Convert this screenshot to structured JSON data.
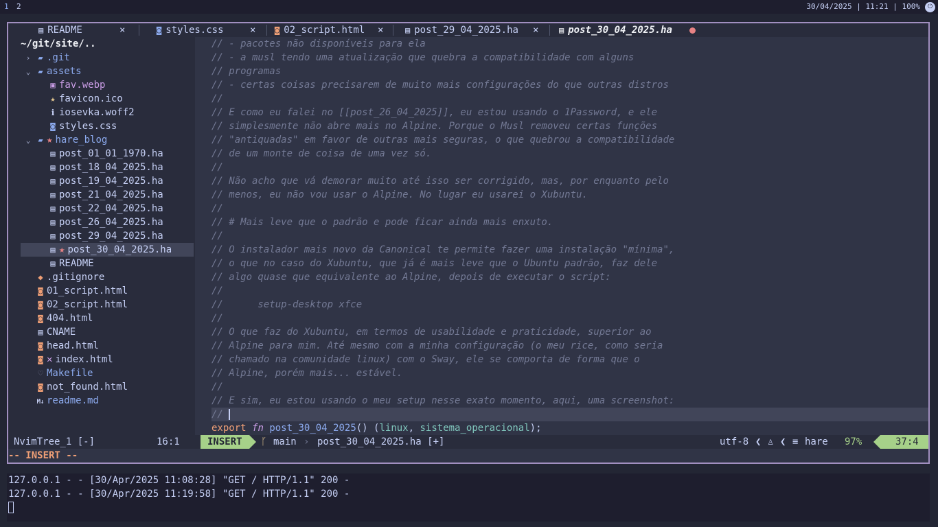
{
  "bar": {
    "workspaces": [
      "1",
      "2"
    ],
    "clock": "30/04/2025 | 11:21 | 100%"
  },
  "tabs": [
    {
      "label": "README",
      "close": "×"
    },
    {
      "label": "styles.css",
      "close": "×"
    },
    {
      "label": "02_script.html",
      "close": "×"
    },
    {
      "label": "post_29_04_2025.ha",
      "close": "×"
    },
    {
      "label": "post_30_04_2025.ha",
      "close": ""
    }
  ],
  "tree": {
    "root": "~/git/site/..",
    "items": [
      {
        "name": ".git",
        "arrow": "›",
        "icon": "▰"
      },
      {
        "name": "assets",
        "arrow": "⌄",
        "icon": "▰"
      },
      {
        "name": "fav.webp",
        "icon": "▣"
      },
      {
        "name": "favicon.ico",
        "icon": "★"
      },
      {
        "name": "iosevka.woff2",
        "icon": "ℹ"
      },
      {
        "name": "styles.css",
        "icon": "◙"
      },
      {
        "name": "hare_blog",
        "arrow": "⌄",
        "icon": "▰",
        "mark": "★"
      },
      {
        "name": "post_01_01_1970.ha",
        "icon": "▤"
      },
      {
        "name": "post_18_04_2025.ha",
        "icon": "▤"
      },
      {
        "name": "post_19_04_2025.ha",
        "icon": "▤"
      },
      {
        "name": "post_21_04_2025.ha",
        "icon": "▤"
      },
      {
        "name": "post_22_04_2025.ha",
        "icon": "▤"
      },
      {
        "name": "post_26_04_2025.ha",
        "icon": "▤"
      },
      {
        "name": "post_29_04_2025.ha",
        "icon": "▤"
      },
      {
        "name": "post_30_04_2025.ha",
        "icon": "▤",
        "mark": "★"
      },
      {
        "name": "README",
        "icon": "▤"
      },
      {
        "name": ".gitignore",
        "icon": "◆"
      },
      {
        "name": "01_script.html",
        "icon": "◙"
      },
      {
        "name": "02_script.html",
        "icon": "◙"
      },
      {
        "name": "404.html",
        "icon": "◙"
      },
      {
        "name": "CNAME",
        "icon": "▤"
      },
      {
        "name": "head.html",
        "icon": "◙"
      },
      {
        "name": "index.html",
        "icon": "◙",
        "mark": "✕"
      },
      {
        "name": "Makefile",
        "icon": "♡"
      },
      {
        "name": "not_found.html",
        "icon": "◙"
      },
      {
        "name": "readme.md",
        "icon": "M↓"
      }
    ]
  },
  "editor": {
    "lines": [
      "// - pacotes não disponíveis para ela",
      "// - a musl tendo uma atualização que quebra a compatibilidade com alguns",
      "// programas",
      "// - certas coisas precisarem de muito mais configurações do que outras distros",
      "//",
      "// E como eu falei no [[post_26_04_2025]], eu estou usando o 1Password, e ele",
      "// simplesmente não abre mais no Alpine. Porque o Musl removeu certas funções",
      "// \"antiquadas\" em favor de outras mais seguras, o que quebrou a compatibilidade",
      "// de um monte de coisa de uma vez só.",
      "//",
      "// Não acho que vá demorar muito até isso ser corrigido, mas, por enquanto pelo",
      "// menos, eu não vou usar o Alpine. No lugar eu usarei o Xubuntu.",
      "//",
      "// # Mais leve que o padrão e pode ficar ainda mais enxuto.",
      "//",
      "// O instalador mais novo da Canonical te permite fazer uma instalação \"mínima\",",
      "// o que no caso do Xubuntu, que já é mais leve que o Ubuntu padrão, faz dele",
      "// algo quase que equivalente ao Alpine, depois de executar o script:",
      "//",
      "//      setup-desktop xfce",
      "//",
      "// O que faz do Xubuntu, em termos de usabilidade e praticidade, superior ao",
      "// Alpine para mim. Até mesmo com a minha configuração (o meu rice, como seria",
      "// chamado na comunidade linux) com o Sway, ele se comporta de forma que o",
      "// Alpine, porém mais... estável.",
      "//",
      "// E sim, eu estou usando o meu setup nesse exato momento, aqui, uma screenshot:"
    ],
    "current_line": "// ",
    "code": {
      "export": "export",
      "fn": "fn",
      "name": "post_30_04_2025",
      "open": "() (",
      "t1": "linux",
      "comma": ", ",
      "t2": "sistema_operacional",
      "close": ");"
    }
  },
  "status": {
    "tree_name": "NvimTree_1 [-]",
    "tree_pos": "16:1",
    "mode": "INSERT",
    "branch": "main",
    "file": "post_30_04_2025.ha [+]",
    "encoding": "utf-8",
    "filetype": "hare",
    "percent": "97%",
    "position": "37:4",
    "cmdline": "-- INSERT --"
  },
  "terminal": {
    "lines": [
      "127.0.0.1 - - [30/Apr/2025 11:08:28] \"GET / HTTP/1.1\" 200 -",
      "127.0.0.1 - - [30/Apr/2025 11:19:58] \"GET / HTTP/1.1\" 200 -"
    ]
  },
  "colors": {
    "accent": "#a6d189",
    "border": "#a18fc0",
    "modified": "#e78284"
  }
}
